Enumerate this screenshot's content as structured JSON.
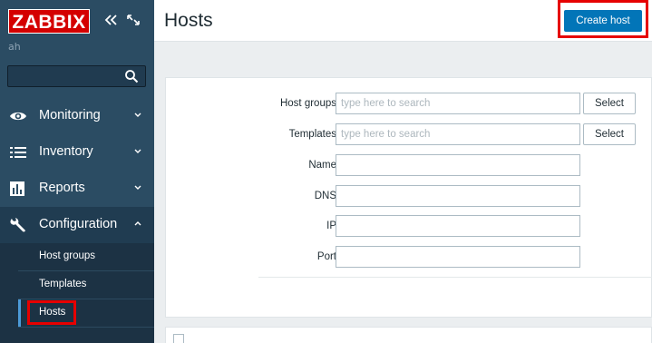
{
  "sidebar": {
    "logo": "ZABBIX",
    "server_name": "ah",
    "search": {
      "value": "",
      "placeholder": ""
    },
    "menu": [
      {
        "label": "Monitoring",
        "icon": "eye-icon",
        "expanded": false
      },
      {
        "label": "Inventory",
        "icon": "list-icon",
        "expanded": false
      },
      {
        "label": "Reports",
        "icon": "bar-chart-icon",
        "expanded": false
      },
      {
        "label": "Configuration",
        "icon": "wrench-icon",
        "expanded": true
      }
    ],
    "submenu": [
      {
        "label": "Host groups"
      },
      {
        "label": "Templates"
      },
      {
        "label": "Hosts",
        "selected": true
      }
    ]
  },
  "header": {
    "title": "Hosts",
    "create_host_label": "Create host"
  },
  "filter": {
    "host_groups": {
      "label": "Host groups",
      "placeholder": "type here to search",
      "value": "",
      "button": "Select"
    },
    "templates": {
      "label": "Templates",
      "placeholder": "type here to search",
      "value": "",
      "button": "Select"
    },
    "name": {
      "label": "Name",
      "value": ""
    },
    "dns": {
      "label": "DNS",
      "value": ""
    },
    "ip": {
      "label": "IP",
      "value": ""
    },
    "port": {
      "label": "Port",
      "value": ""
    }
  },
  "colors": {
    "sidebar_bg": "#2b4c63",
    "logo_red": "#d40000",
    "primary_button": "#0275b8",
    "highlight_box": "#e60000"
  }
}
